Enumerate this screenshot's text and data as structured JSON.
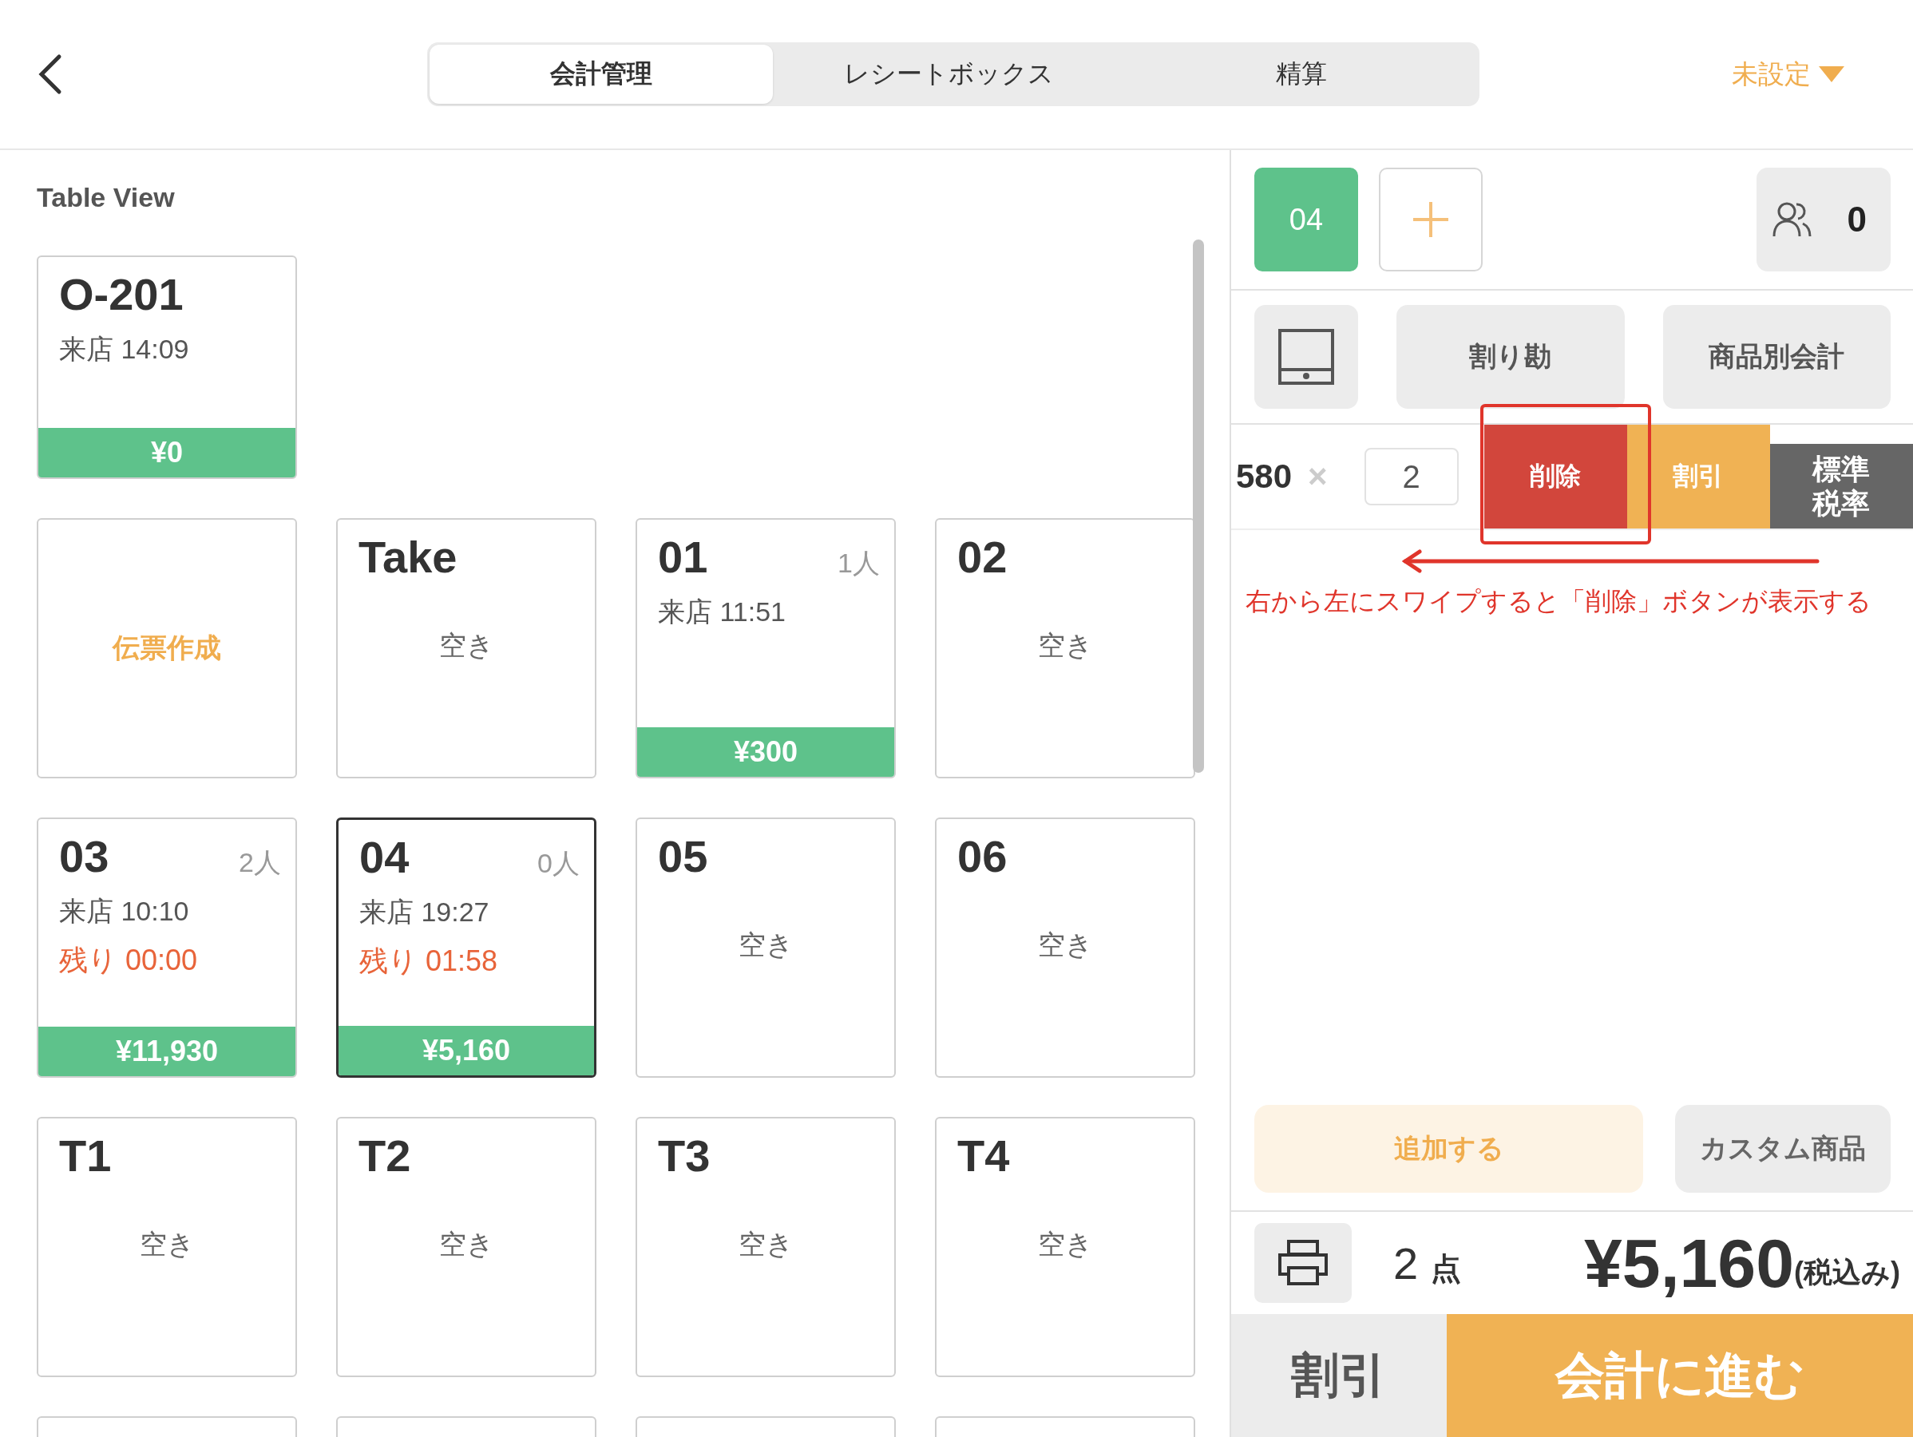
{
  "top_bar": {
    "tabs": [
      {
        "label": "会計管理",
        "selected": true
      },
      {
        "label": "レシートボックス",
        "selected": false
      },
      {
        "label": "精算",
        "selected": false
      }
    ],
    "printer_setting": "未設定"
  },
  "table_view": {
    "title": "Table View",
    "rows": [
      [
        {
          "kind": "table",
          "name": "O-201",
          "arrival": "来店 14:09",
          "amount": "¥0",
          "selected": false
        }
      ],
      [
        {
          "kind": "new",
          "label": "伝票作成",
          "selected": false
        },
        {
          "kind": "table",
          "name": "Take",
          "status": "空き",
          "selected": false
        },
        {
          "kind": "table",
          "name": "01",
          "guests": "1人",
          "arrival": "来店 11:51",
          "amount": "¥300",
          "selected": false
        },
        {
          "kind": "table",
          "name": "02",
          "status": "空き",
          "selected": false
        }
      ],
      [
        {
          "kind": "table",
          "name": "03",
          "guests": "2人",
          "arrival": "来店 10:10",
          "remaining": "残り 00:00",
          "amount": "¥11,930",
          "selected": false
        },
        {
          "kind": "table",
          "name": "04",
          "guests": "0人",
          "arrival": "来店 19:27",
          "remaining": "残り 01:58",
          "amount": "¥5,160",
          "selected": true
        },
        {
          "kind": "table",
          "name": "05",
          "status": "空き",
          "selected": false
        },
        {
          "kind": "table",
          "name": "06",
          "status": "空き",
          "selected": false
        }
      ],
      [
        {
          "kind": "table",
          "name": "T1",
          "status": "空き",
          "selected": false
        },
        {
          "kind": "table",
          "name": "T2",
          "status": "空き",
          "selected": false
        },
        {
          "kind": "table",
          "name": "T3",
          "status": "空き",
          "selected": false
        },
        {
          "kind": "table",
          "name": "T4",
          "status": "空き",
          "selected": false
        }
      ]
    ]
  },
  "order_panel": {
    "table_tabs": [
      {
        "label": "04",
        "selected": true
      }
    ],
    "guests": "0",
    "actions": [
      "割り勘",
      "商品別会計"
    ],
    "line_item": {
      "price": "580",
      "times": "×",
      "quantity": "2",
      "swipe_actions": [
        {
          "label": "削除",
          "kind": "delete"
        },
        {
          "label": "割引",
          "kind": "discount"
        },
        {
          "label": "標準税率",
          "kind": "tax"
        }
      ]
    },
    "annotation": "右から左にスワイプすると「削除」ボタンが表示する",
    "add_buttons": [
      {
        "label": "追加する",
        "kind": "primary"
      },
      {
        "label": "カスタム商品",
        "kind": "secondary"
      }
    ],
    "item_count": "2",
    "count_unit": "点",
    "total": "¥5,160",
    "tax_note": "(税込み)",
    "discount_button": "割引",
    "checkout_button": "会計に進む"
  }
}
